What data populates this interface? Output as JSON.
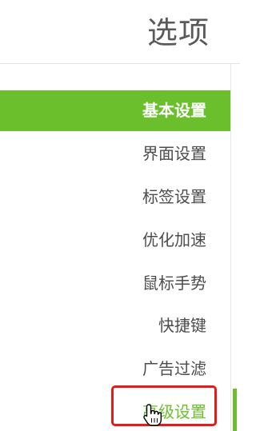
{
  "header": {
    "title": "选项"
  },
  "sidebar": {
    "items": [
      {
        "label": "基本设置",
        "state": "active"
      },
      {
        "label": "界面设置",
        "state": "normal"
      },
      {
        "label": "标签设置",
        "state": "normal"
      },
      {
        "label": "优化加速",
        "state": "normal"
      },
      {
        "label": "鼠标手势",
        "state": "normal"
      },
      {
        "label": "快捷键",
        "state": "normal"
      },
      {
        "label": "广告过滤",
        "state": "normal"
      },
      {
        "label": "高级设置",
        "state": "hovered"
      }
    ]
  },
  "colors": {
    "accent": "#6cbf2c",
    "title_text": "#5a5a5a",
    "item_text": "#4c4c4c",
    "highlight_border": "#e41b1b"
  },
  "icons": {
    "cursor": "hand-pointer-icon"
  }
}
